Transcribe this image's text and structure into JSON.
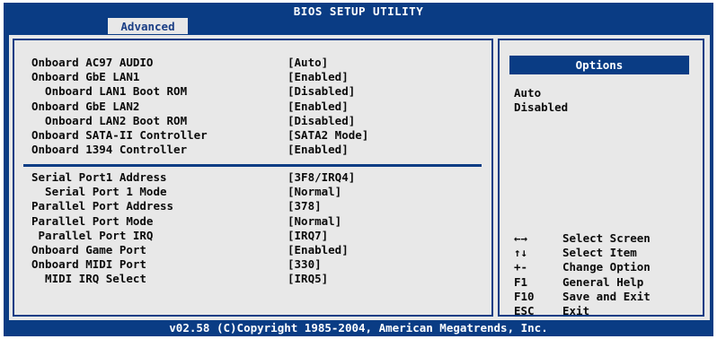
{
  "header": {
    "title": "BIOS SETUP UTILITY",
    "active_tab": "Advanced"
  },
  "settings_group1": [
    {
      "label": "Onboard AC97 AUDIO",
      "value": "[Auto]"
    },
    {
      "label": "Onboard GbE LAN1",
      "value": "[Enabled]"
    },
    {
      "label": "  Onboard LAN1 Boot ROM",
      "value": "[Disabled]"
    },
    {
      "label": "Onboard GbE LAN2",
      "value": "[Enabled]"
    },
    {
      "label": "  Onboard LAN2 Boot ROM",
      "value": "[Disabled]"
    },
    {
      "label": "Onboard SATA-II Controller",
      "value": "[SATA2 Mode]"
    },
    {
      "label": "Onboard 1394 Controller",
      "value": "[Enabled]"
    }
  ],
  "settings_group2": [
    {
      "label": "Serial Port1 Address",
      "value": "[3F8/IRQ4]"
    },
    {
      "label": "  Serial Port 1 Mode",
      "value": "[Normal]"
    },
    {
      "label": "Parallel Port Address",
      "value": "[378]"
    },
    {
      "label": "Parallel Port Mode",
      "value": "[Normal]"
    },
    {
      "label": " Parallel Port IRQ",
      "value": "[IRQ7]"
    },
    {
      "label": "Onboard Game Port",
      "value": "[Enabled]"
    },
    {
      "label": "Onboard MIDI Port",
      "value": "[330]"
    },
    {
      "label": "  MIDI IRQ Select",
      "value": "[IRQ5]"
    }
  ],
  "options_panel": {
    "header": "Options",
    "items": [
      "Auto",
      "Disabled"
    ]
  },
  "key_help": [
    {
      "key": "←→",
      "desc": "Select Screen"
    },
    {
      "key": "↑↓",
      "desc": "Select Item"
    },
    {
      "key": "+-",
      "desc": "Change Option"
    },
    {
      "key": "F1",
      "desc": "General Help"
    },
    {
      "key": "F10",
      "desc": "Save and Exit"
    },
    {
      "key": "ESC",
      "desc": "Exit"
    }
  ],
  "footer": {
    "text": "v02.58 (C)Copyright 1985-2004, American Megatrends, Inc."
  },
  "colors": {
    "background_blue": "#0a3c84",
    "panel_gray": "#e8e8e8",
    "text": "#0b0b0b"
  }
}
